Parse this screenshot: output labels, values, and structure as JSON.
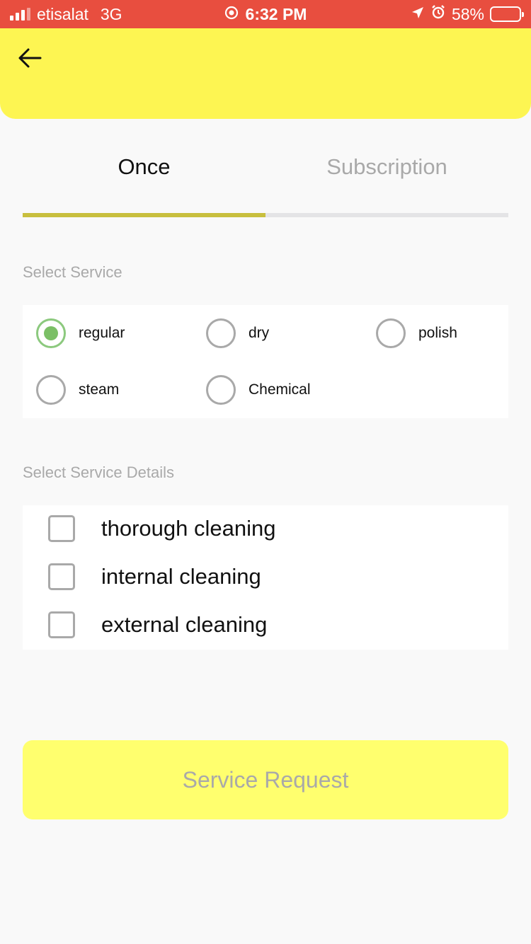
{
  "status_bar": {
    "carrier": "etisalat",
    "network": "3G",
    "time": "6:32 PM",
    "battery": "58%",
    "battery_level": 0.58,
    "icons": [
      "signal-icon",
      "record-icon",
      "location-icon",
      "alarm-icon",
      "battery-icon"
    ]
  },
  "header": {
    "back_icon": "arrow-left-icon",
    "background": "#fdf552"
  },
  "tabs": [
    {
      "label": "Once",
      "active": true
    },
    {
      "label": "Subscription",
      "active": false
    }
  ],
  "service": {
    "label": "Select Service",
    "options": [
      {
        "label": "regular",
        "selected": true
      },
      {
        "label": "dry",
        "selected": false
      },
      {
        "label": "polish",
        "selected": false
      },
      {
        "label": "steam",
        "selected": false
      },
      {
        "label": "Chemical",
        "selected": false
      }
    ]
  },
  "details": {
    "label": "Select Service Details",
    "options": [
      {
        "label": "thorough cleaning",
        "checked": false
      },
      {
        "label": "internal cleaning",
        "checked": false
      },
      {
        "label": "external cleaning",
        "checked": false
      }
    ]
  },
  "submit": {
    "label": "Service Request",
    "enabled": false
  },
  "colors": {
    "status_bar": "#e84e3f",
    "header": "#fdf552",
    "tab_indicator": "#c8bf3e",
    "radio_selected": "#7bbf66",
    "button": "#ffff6e"
  }
}
